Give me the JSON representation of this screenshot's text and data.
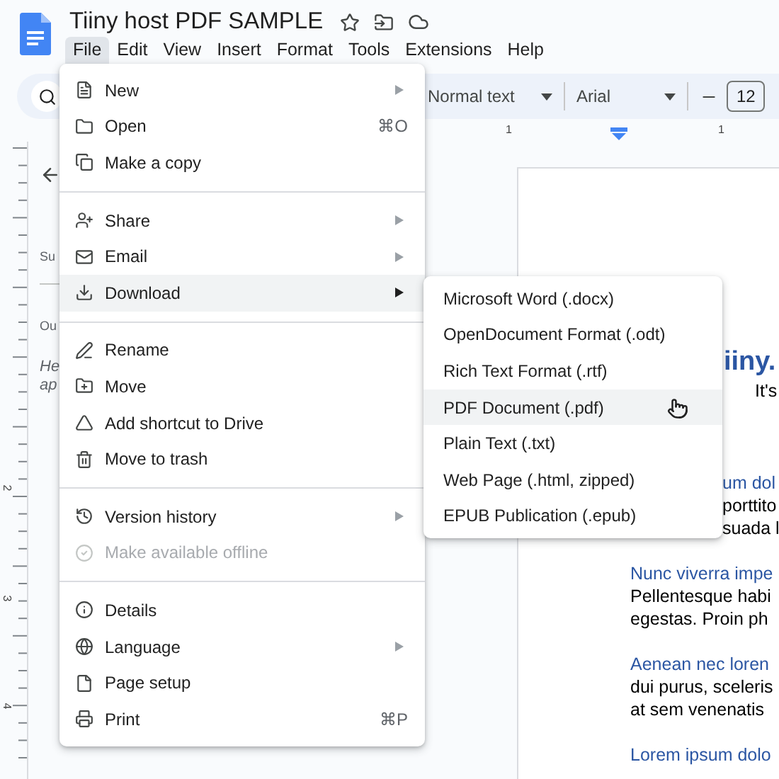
{
  "document": {
    "title": "Tiiny host PDF SAMPLE",
    "menubar": [
      {
        "label": "File",
        "selected": true
      },
      {
        "label": "Edit",
        "selected": false
      },
      {
        "label": "View",
        "selected": false
      },
      {
        "label": "Insert",
        "selected": false
      },
      {
        "label": "Format",
        "selected": false
      },
      {
        "label": "Tools",
        "selected": false
      },
      {
        "label": "Extensions",
        "selected": false
      },
      {
        "label": "Help",
        "selected": false
      }
    ]
  },
  "toolbar": {
    "style": "Normal text",
    "font": "Arial",
    "font_size": "12"
  },
  "rulers": {
    "top_labels": [
      "1",
      "1"
    ],
    "left_labels": [
      "2",
      "3",
      "4"
    ]
  },
  "side_panel": {
    "lines": [
      {
        "kind": "label",
        "text": "Su"
      },
      {
        "kind": "label",
        "text": "Ou"
      },
      {
        "kind": "hint",
        "text": "He"
      },
      {
        "kind": "hint",
        "text": "ap"
      }
    ]
  },
  "page": [
    {
      "kind": "title_fragment",
      "text": "iiny."
    },
    {
      "kind": "subtitle_fragment",
      "text": "It's"
    },
    {
      "kind": "heading_fragment",
      "text": "um dol"
    },
    {
      "kind": "body_fragment",
      "text": "porttito"
    },
    {
      "kind": "body_fragment",
      "text": "suada l"
    },
    {
      "kind": "heading",
      "text": "Nunc viverra impe"
    },
    {
      "kind": "body",
      "text": "Pellentesque habi"
    },
    {
      "kind": "body",
      "text": "egestas. Proin ph"
    },
    {
      "kind": "heading",
      "text": "Aenean nec loren"
    },
    {
      "kind": "body",
      "text": "dui purus, sceleris"
    },
    {
      "kind": "body",
      "text": "at sem venenatis"
    },
    {
      "kind": "heading",
      "text": "Lorem ipsum dolo"
    }
  ],
  "file_menu": {
    "groups": [
      [
        {
          "label": "New",
          "has_submenu": true,
          "selected": false,
          "disabled": false
        },
        {
          "label": "Open",
          "shortcut": "⌘O",
          "has_submenu": false,
          "selected": false,
          "disabled": false
        },
        {
          "label": "Make a copy",
          "has_submenu": false,
          "selected": false,
          "disabled": false
        }
      ],
      [
        {
          "label": "Share",
          "has_submenu": true,
          "selected": false,
          "disabled": false
        },
        {
          "label": "Email",
          "has_submenu": true,
          "selected": false,
          "disabled": false
        },
        {
          "label": "Download",
          "has_submenu": true,
          "selected": true,
          "disabled": false
        }
      ],
      [
        {
          "label": "Rename",
          "has_submenu": false,
          "selected": false,
          "disabled": false
        },
        {
          "label": "Move",
          "has_submenu": false,
          "selected": false,
          "disabled": false
        },
        {
          "label": "Add shortcut to Drive",
          "has_submenu": false,
          "selected": false,
          "disabled": false
        },
        {
          "label": "Move to trash",
          "has_submenu": false,
          "selected": false,
          "disabled": false
        }
      ],
      [
        {
          "label": "Version history",
          "has_submenu": true,
          "selected": false,
          "disabled": false
        },
        {
          "label": "Make available offline",
          "has_submenu": false,
          "selected": false,
          "disabled": true
        }
      ],
      [
        {
          "label": "Details",
          "has_submenu": false,
          "selected": false,
          "disabled": false
        },
        {
          "label": "Language",
          "has_submenu": true,
          "selected": false,
          "disabled": false
        },
        {
          "label": "Page setup",
          "has_submenu": false,
          "selected": false,
          "disabled": false
        },
        {
          "label": "Print",
          "shortcut": "⌘P",
          "has_submenu": false,
          "selected": false,
          "disabled": false
        }
      ]
    ]
  },
  "download_menu": {
    "items": [
      {
        "label": "Microsoft Word (.docx)",
        "selected": false
      },
      {
        "label": "OpenDocument Format (.odt)",
        "selected": false
      },
      {
        "label": "Rich Text Format (.rtf)",
        "selected": false
      },
      {
        "label": "PDF Document (.pdf)",
        "selected": true
      },
      {
        "label": "Plain Text (.txt)",
        "selected": false
      },
      {
        "label": "Web Page (.html, zipped)",
        "selected": false
      },
      {
        "label": "EPUB Publication (.epub)",
        "selected": false
      }
    ]
  }
}
